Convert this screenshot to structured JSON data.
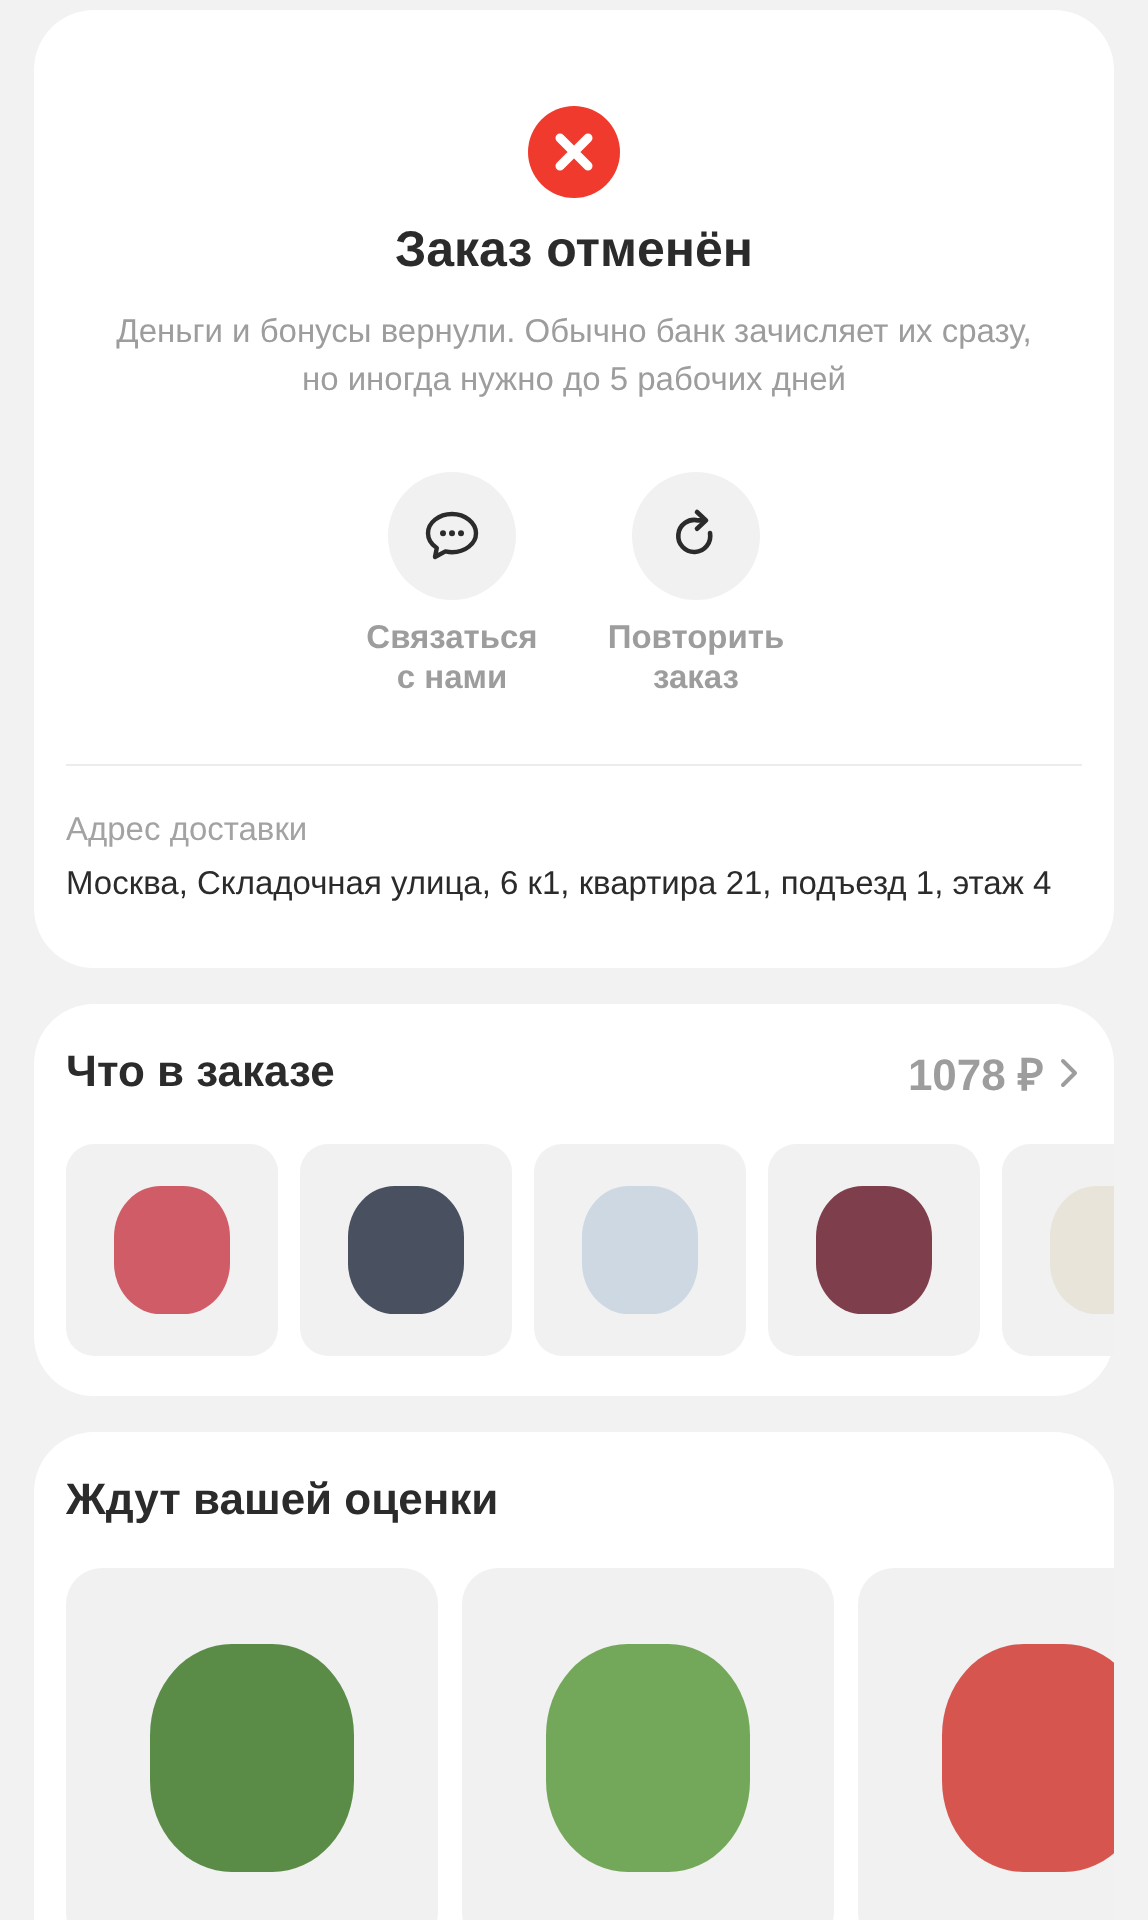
{
  "status": {
    "title": "Заказ отменён",
    "message": "Деньги и бонусы вернули. Обычно банк зачисляет их сразу, но иногда нужно до 5 рабочих дней",
    "actions": [
      {
        "kind": "chat",
        "label": "Связаться с нами"
      },
      {
        "kind": "repeat",
        "label": "Повторить заказ"
      }
    ],
    "address": {
      "label": "Адрес доставки",
      "value": "Москва, Складочная улица, 6 к1, квартира 21, подъезд 1, этаж 4"
    }
  },
  "order": {
    "title": "Что в заказе",
    "total": "1078 ₽"
  },
  "rating": {
    "title": "Ждут вашей оценки"
  }
}
